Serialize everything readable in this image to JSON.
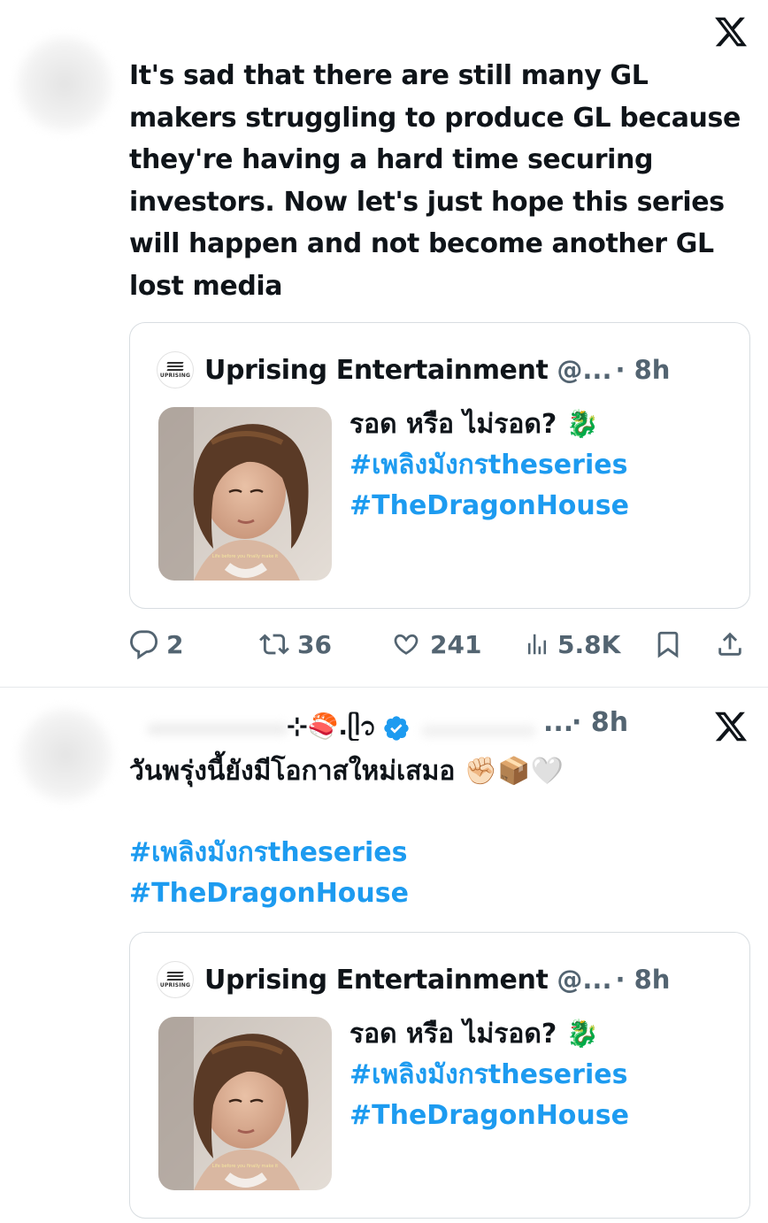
{
  "tweet1": {
    "text": "It's sad that there are still many GL makers struggling to produce GL because they're having a hard time securing investors. Now let's just hope this series will happen and not become another GL lost media",
    "quote": {
      "logo_text": "UPRISING",
      "name": "Uprising Entertainment",
      "handle": "@...",
      "time": "· 8h",
      "text_line": "รอด หรือ ไม่รอด? 🐉",
      "hashtag1": "#เพลิงมังกรtheseries",
      "hashtag2": "#TheDragonHouse",
      "image_caption": "Life before you finally make it"
    },
    "actions": {
      "replies": "2",
      "retweets": "36",
      "likes": "241",
      "views": "5.8K"
    }
  },
  "tweet2": {
    "display_name_suffix": "⊹🍣.ᥫ᭡",
    "handle": "...",
    "time": "· 8h",
    "text_line": "วันพรุ่งนี้ยังมีโอกาสใหม่เสมอ ✊🏻📦🤍",
    "hashtag1": "#เพลิงมังกรtheseries",
    "hashtag2": "#TheDragonHouse",
    "quote": {
      "logo_text": "UPRISING",
      "name": "Uprising Entertainment",
      "handle": "@...",
      "time": "· 8h",
      "text_line": "รอด หรือ ไม่รอด? 🐉",
      "hashtag1": "#เพลิงมังกรtheseries",
      "hashtag2": "#TheDragonHouse",
      "image_caption": "Life before you finally make it"
    }
  },
  "colors": {
    "text": "#0f1419",
    "muted": "#536471",
    "link": "#1d9bf0",
    "border": "#d8dde1",
    "verified": "#1d9bf0"
  },
  "icons": [
    "x-logo-icon",
    "reply-icon",
    "retweet-icon",
    "like-icon",
    "views-icon",
    "bookmark-icon",
    "share-icon",
    "verified-badge-icon",
    "uprising-logo"
  ]
}
